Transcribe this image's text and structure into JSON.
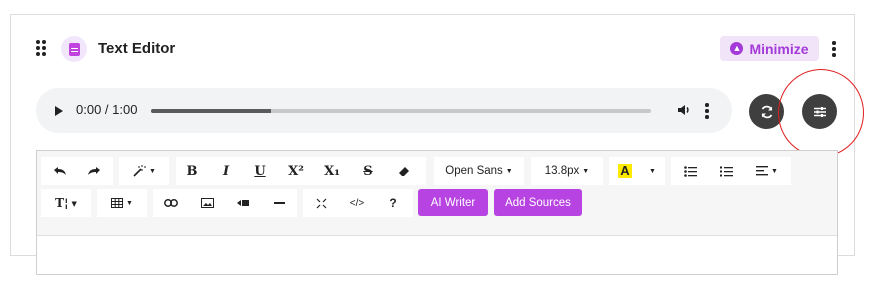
{
  "header": {
    "title": "Text Editor",
    "minimize_label": "Minimize"
  },
  "audio": {
    "time": "0:00 / 1:00",
    "progress": 0.24
  },
  "toolbar": {
    "font_family": "Open Sans",
    "font_size": "13.8px",
    "highlight_glyph": "A",
    "bold": "B",
    "italic": "I",
    "underline": "U",
    "superscript": "X²",
    "subscript": "X₁",
    "strike": "S",
    "text_style": "T¦",
    "code": "</>",
    "help": "?",
    "ai_writer": "AI Writer",
    "add_sources": "Add Sources"
  },
  "colors": {
    "accent": "#b743e2",
    "highlight": "#ffeb00",
    "annotation_ring": "#e01e1e"
  }
}
